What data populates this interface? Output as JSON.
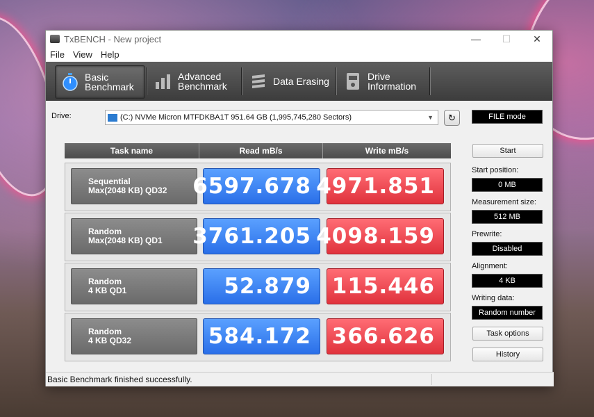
{
  "window": {
    "title": "TxBENCH - New project"
  },
  "menu": [
    "File",
    "View",
    "Help"
  ],
  "tabs": [
    {
      "line1": "Basic",
      "line2": "Benchmark",
      "icon": "stopwatch-icon"
    },
    {
      "line1": "Advanced",
      "line2": "Benchmark",
      "icon": "bar-chart-icon"
    },
    {
      "line1": "Data Erasing",
      "line2": "",
      "icon": "eraser-icon"
    },
    {
      "line1": "Drive",
      "line2": "Information",
      "icon": "drive-info-icon"
    }
  ],
  "drive": {
    "label": "Drive:",
    "value": "(C:) NVMe Micron MTFDKBA1T  951.64 GB (1,995,745,280 Sectors)"
  },
  "mode_button": "FILE mode",
  "table": {
    "headers": [
      "Task name",
      "Read mB/s",
      "Write mB/s"
    ],
    "rows": [
      {
        "task_line1": "Sequential",
        "task_line2": "Max(2048 KB) QD32",
        "read": "6597.678",
        "write": "4971.851"
      },
      {
        "task_line1": "Random",
        "task_line2": "Max(2048 KB) QD1",
        "read": "3761.205",
        "write": "4098.159"
      },
      {
        "task_line1": "Random",
        "task_line2": "4 KB QD1",
        "read": "52.879",
        "write": "115.446"
      },
      {
        "task_line1": "Random",
        "task_line2": "4 KB QD32",
        "read": "584.172",
        "write": "366.626"
      }
    ]
  },
  "side": {
    "start": "Start",
    "start_position_label": "Start position:",
    "start_position": "0 MB",
    "measurement_size_label": "Measurement size:",
    "measurement_size": "512 MB",
    "prewrite_label": "Prewrite:",
    "prewrite": "Disabled",
    "alignment_label": "Alignment:",
    "alignment": "4 KB",
    "writing_data_label": "Writing data:",
    "writing_data": "Random number",
    "task_options": "Task options",
    "history": "History"
  },
  "status": "Basic Benchmark finished successfully.",
  "colors": {
    "read": "#2a6fe8",
    "write": "#e0323c",
    "toolbar": "#4a4a4a"
  }
}
